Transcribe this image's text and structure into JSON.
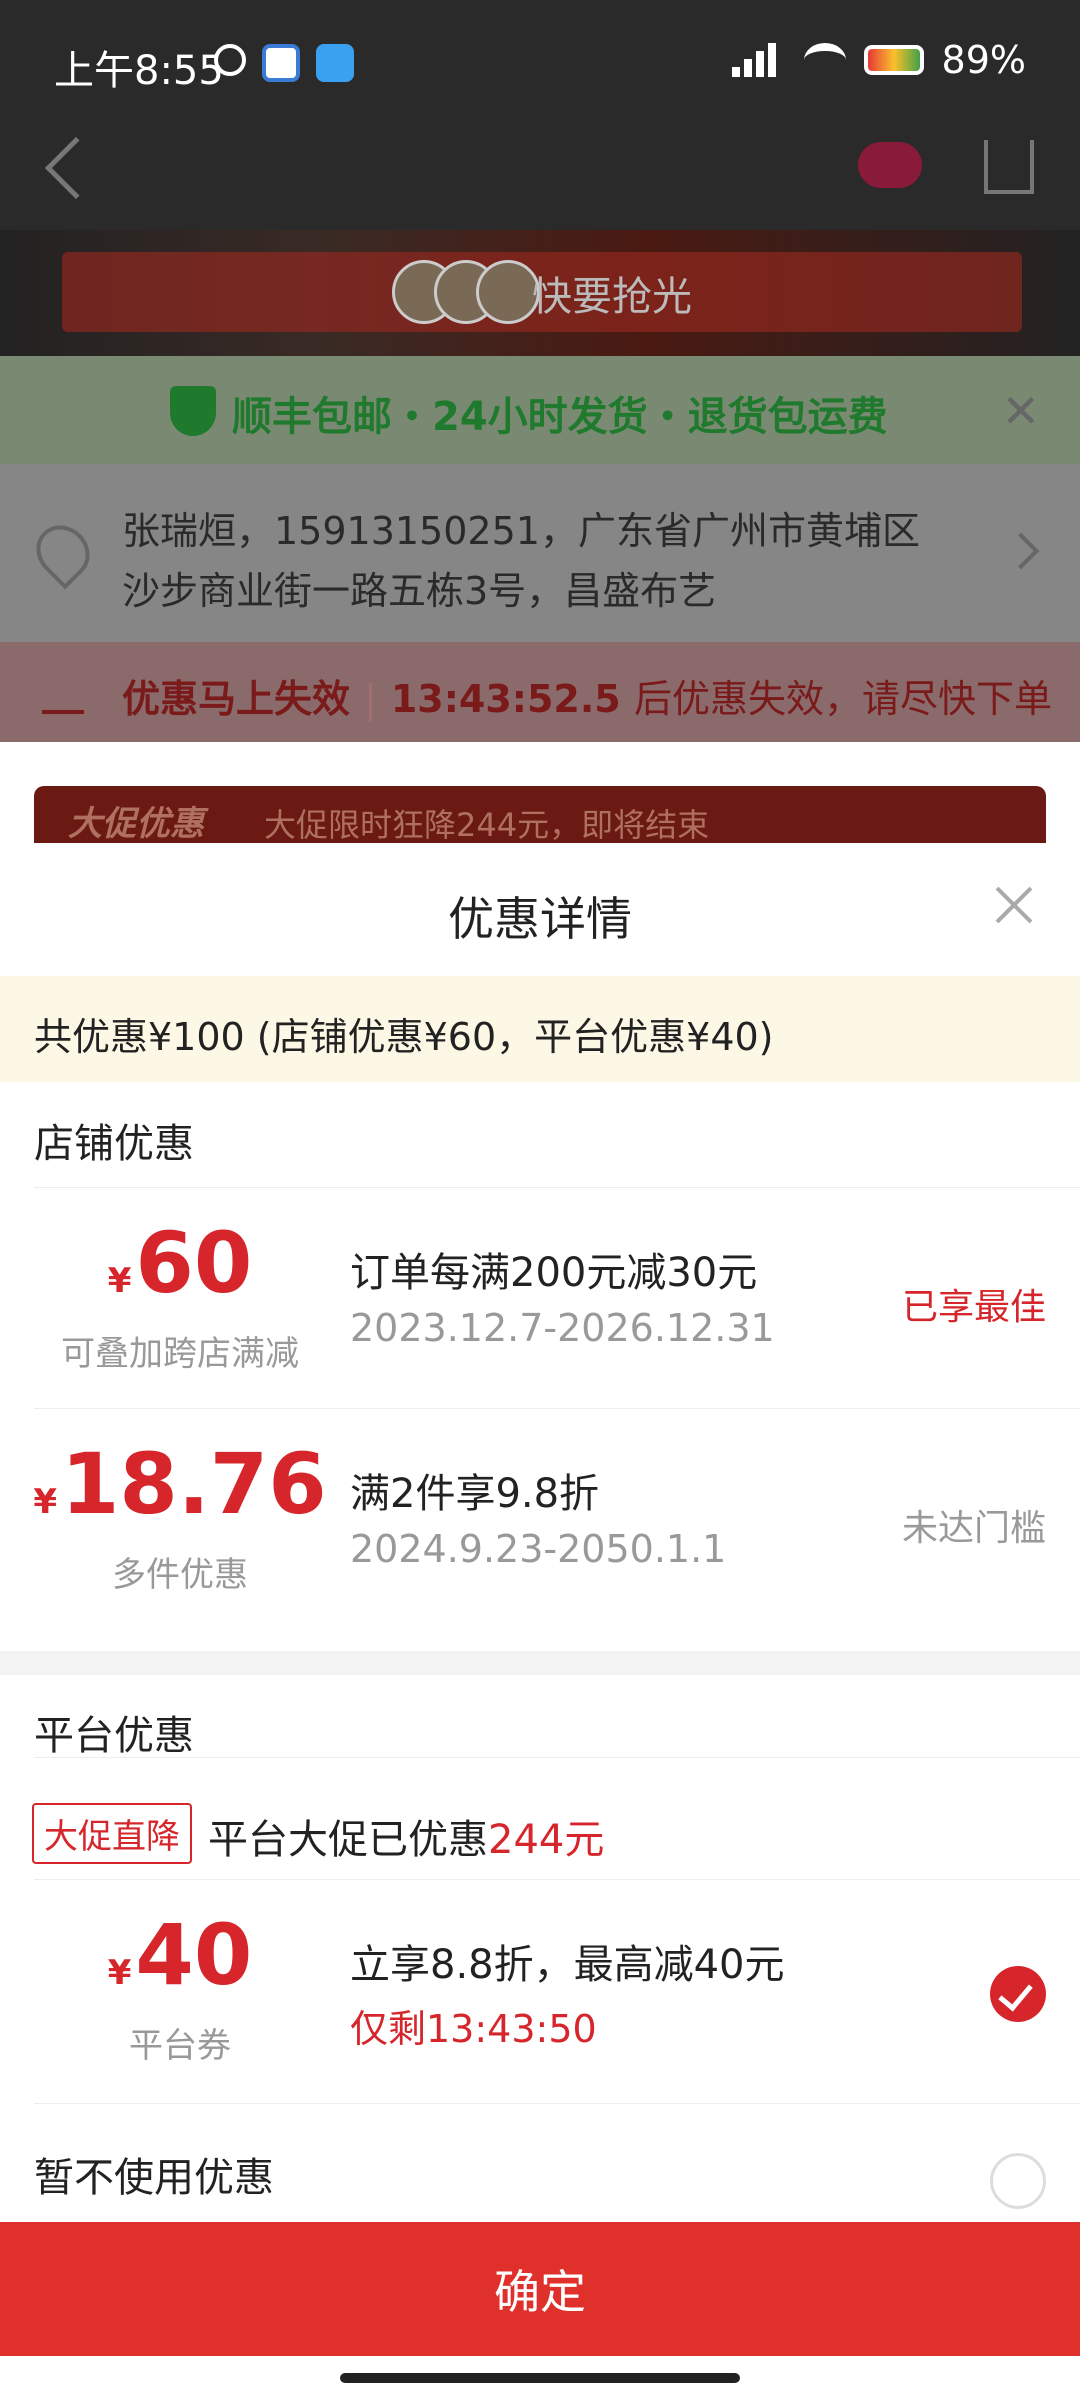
{
  "status_bar": {
    "time": "上午8:55",
    "battery": "89%"
  },
  "background": {
    "hero_text": "快要抢光",
    "shipping_text": "顺丰包邮・24小时发货・退货包运费",
    "address_line1": "张瑞烜，15913150251，广东省广州市黄埔区",
    "address_line2": "沙步商业街一路五栋3号，昌盛布艺",
    "countdown_label": "优惠马上失效",
    "countdown_time": "13:43:52.5",
    "countdown_suffix": "后优惠失效，请尽快下单",
    "promo_tag": "大促优惠",
    "promo_text": "大促限时狂降244元，即将结束"
  },
  "sheet": {
    "title": "优惠详情",
    "summary": "共优惠¥100 (店铺优惠¥60，平台优惠¥40)",
    "store_section_title": "店铺优惠",
    "store_coupons": [
      {
        "currency": "¥",
        "amount": "60",
        "subtitle": "可叠加跨店满减",
        "title": "订单每满200元减30元",
        "date": "2023.12.7-2026.12.31",
        "status": "已享最佳"
      },
      {
        "currency": "¥",
        "amount": "18.76",
        "subtitle": "多件优惠",
        "title": "满2件享9.8折",
        "date": "2024.9.23-2050.1.1",
        "status": "未达门槛"
      }
    ],
    "platform_section_title": "平台优惠",
    "promo_direct": {
      "badge": "大促直降",
      "text": "平台大促已优惠",
      "amount": "244元"
    },
    "platform_coupon": {
      "currency": "¥",
      "amount": "40",
      "subtitle": "平台券",
      "title": "立享8.8折，最高减40元",
      "remaining": "仅剩13:43:50",
      "selected": true
    },
    "no_coupon_label": "暂不使用优惠",
    "confirm_label": "确定"
  },
  "colors": {
    "accent_red": "#d6262b",
    "button_red": "#e0302b",
    "summary_bg": "#fdf8e6"
  }
}
